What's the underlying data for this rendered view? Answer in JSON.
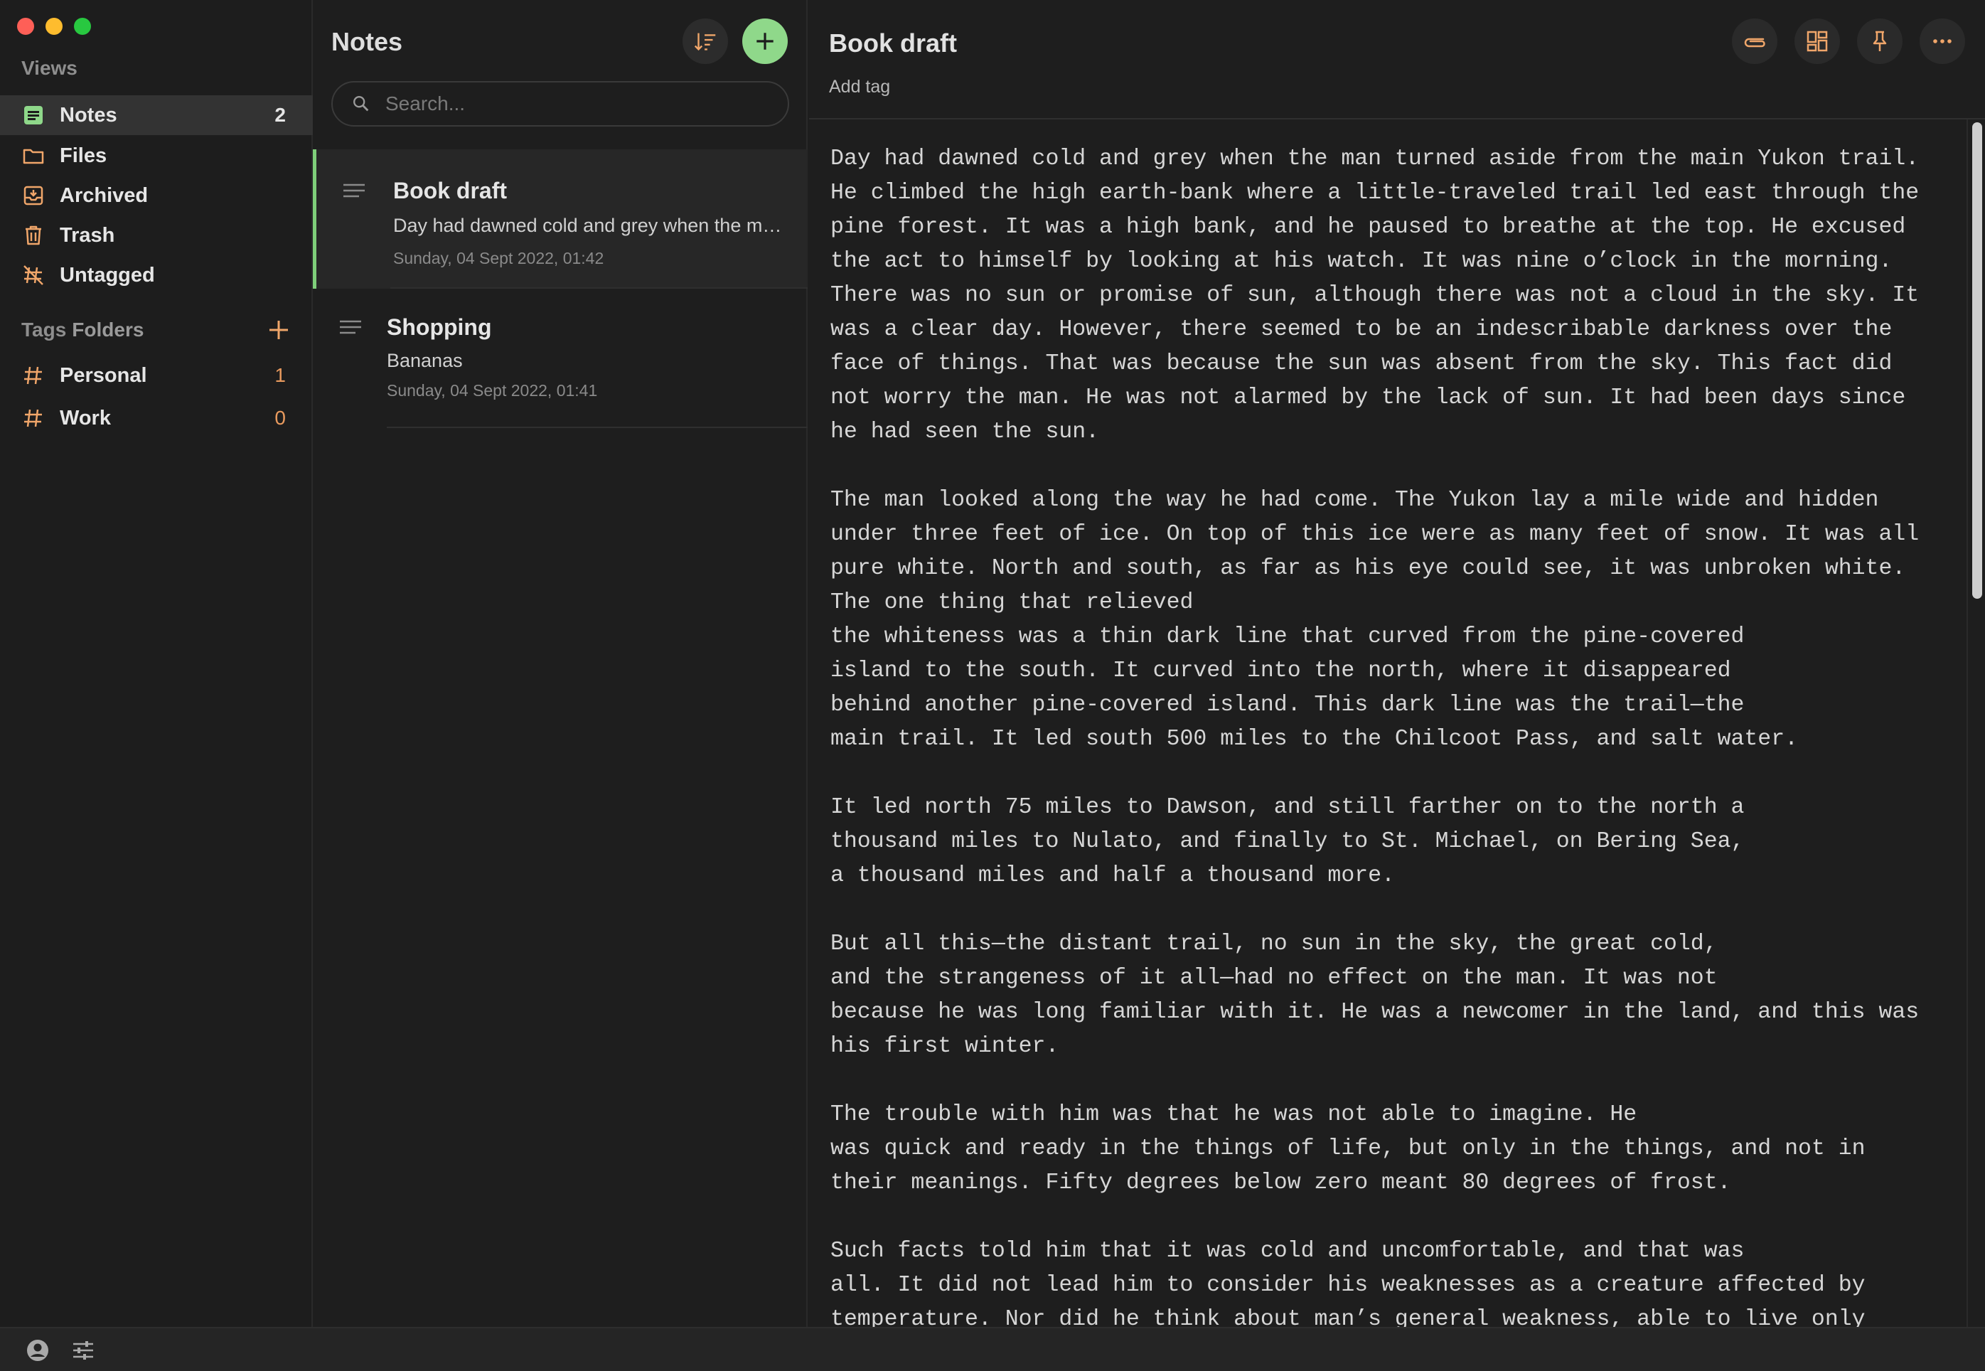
{
  "sidebar": {
    "views_title": "Views",
    "items": [
      {
        "label": "Notes",
        "count": "2"
      },
      {
        "label": "Files"
      },
      {
        "label": "Archived"
      },
      {
        "label": "Trash"
      },
      {
        "label": "Untagged"
      }
    ],
    "tags_title": "Tags",
    "folders_title": "Folders",
    "tags": [
      {
        "label": "Personal",
        "count": "1"
      },
      {
        "label": "Work",
        "count": "0"
      }
    ]
  },
  "notes_list": {
    "title": "Notes",
    "search_placeholder": "Search...",
    "notes": [
      {
        "title": "Book draft",
        "preview": "Day had dawned cold and grey when the man turned aside from the main Yukon trail.",
        "date": "Sunday, 04 Sept 2022, 01:42"
      },
      {
        "title": "Shopping",
        "preview": "Bananas",
        "date": "Sunday, 04 Sept 2022, 01:41"
      }
    ]
  },
  "editor": {
    "title": "Book draft",
    "add_tag": "Add tag",
    "lines": [
      "Day had dawned cold and grey when the man turned aside from the main Yukon trail.",
      "He climbed the high earth-bank where a little-traveled trail led east through the",
      "pine forest. It was a high bank, and he paused to breathe at the top. He excused",
      "the act to himself by looking at his watch. It was nine o’clock in the morning.",
      "There was no sun or promise of sun, although there was not a cloud in the sky. It",
      "was a clear day. However, there seemed to be an indescribable darkness over the",
      "face of things. That was because the sun was absent from the sky. This fact did",
      "not worry the man. He was not alarmed by the lack of sun. It had been days since",
      "he had seen the sun.",
      "",
      "The man looked along the way he had come. The Yukon lay a mile wide and hidden",
      "under three feet of ice. On top of this ice were as many feet of snow. It was all",
      "pure white. North and south, as far as his eye could see, it was unbroken white.",
      "The one thing that relieved",
      "the whiteness was a thin dark line that curved from the pine-covered",
      "island to the south. It curved into the north, where it disappeared",
      "behind another pine-covered island. This dark line was the trail—the",
      "main trail. It led south 500 miles to the Chilcoot Pass, and salt water.",
      "",
      "It led north 75 miles to Dawson, and still farther on to the north a",
      "thousand miles to Nulato, and finally to St. Michael, on Bering Sea,",
      "a thousand miles and half a thousand more.",
      "",
      "But all this—the distant trail, no sun in the sky, the great cold,",
      "and the strangeness of it all—had no effect on the man. It was not",
      "because he was long familiar with it. He was a newcomer in the land, and this was",
      "his first winter.",
      "",
      "The trouble with him was that he was not able to imagine. He",
      "was quick and ready in the things of life, but only in the things, and not in",
      "their meanings. Fifty degrees below zero meant 80 degrees of frost.",
      "",
      "Such facts told him that it was cold and uncomfortable, and that was",
      "all. It did not lead him to consider his weaknesses as a creature affected by",
      "temperature. Nor did he think about man’s general weakness, able to live only"
    ]
  },
  "colors": {
    "accent_green": "#8fd88a",
    "tag_orange": "#e89a5e",
    "icon_orange": "#f0a66a"
  }
}
